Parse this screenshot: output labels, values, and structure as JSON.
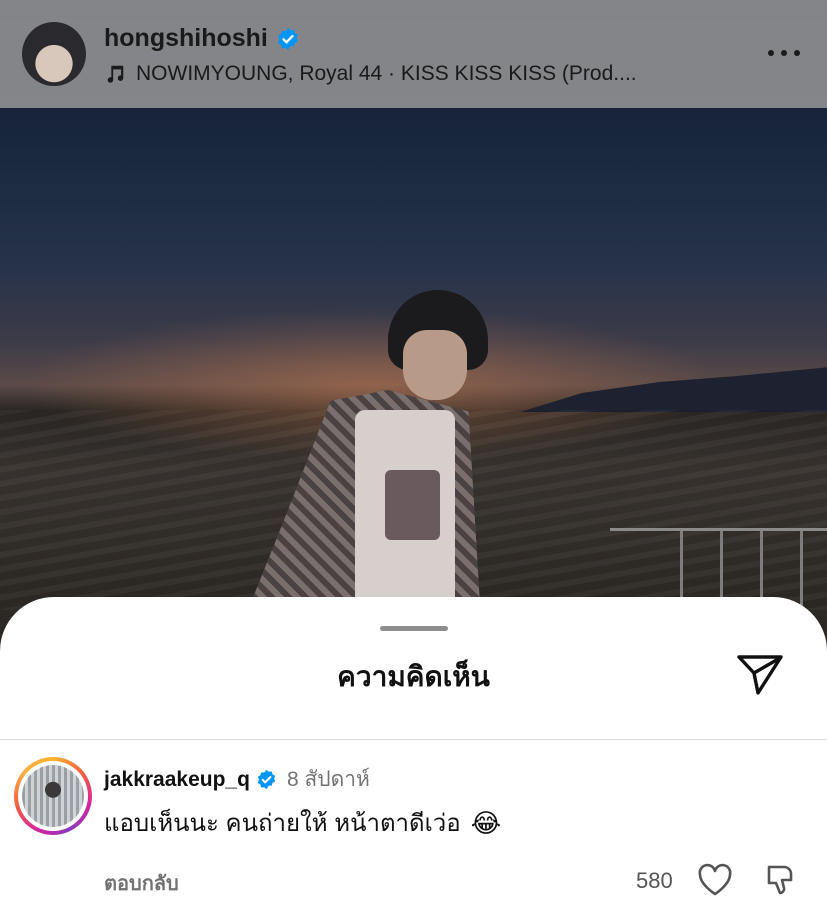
{
  "post": {
    "username": "hongshihoshi",
    "verified": true,
    "music": "NOWIMYOUNG, Royal 44 · KISS KISS KISS (Prod....",
    "icons": {
      "avatar": "profile-avatar",
      "music": "music-note-icon",
      "more": "more-horizontal-icon"
    }
  },
  "sheet": {
    "title": "ความคิดเห็น",
    "share_icon": "send-icon"
  },
  "comment": {
    "username": "jakkraakeup_q",
    "verified": true,
    "time": "8 สัปดาห์",
    "text": "แอบเห็นนะ คนถ่ายให้ หน้าตาดีเว่อ",
    "emoji": "😂",
    "reply_label": "ตอบกลับ",
    "likes": "580",
    "icons": {
      "like": "heart-icon",
      "dislike": "dislike-icon"
    }
  },
  "colors": {
    "verified_blue": "#0095f6",
    "muted_text": "#737373",
    "story_ring": [
      "#fcaf45",
      "#f56040",
      "#d6249f",
      "#8a3ab9"
    ]
  }
}
